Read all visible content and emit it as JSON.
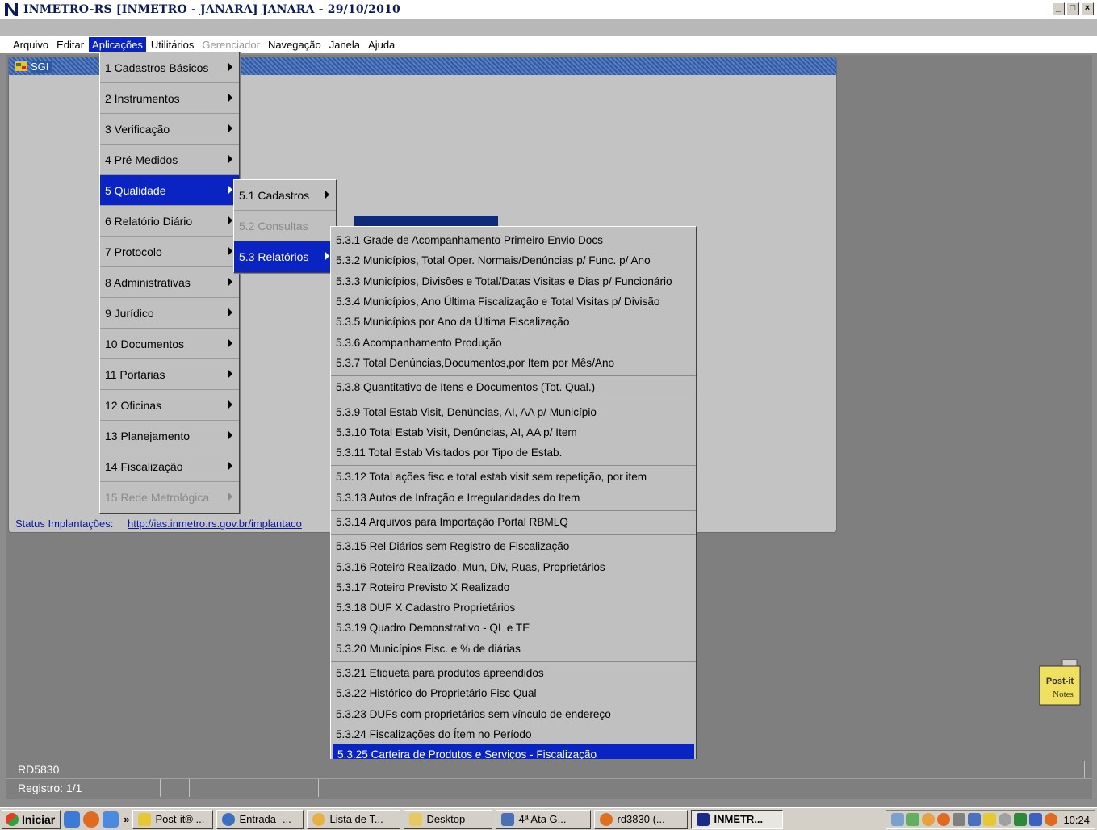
{
  "window": {
    "title": "INMETRO-RS  [INMETRO - JANARA]   JANARA - 29/10/2010",
    "controls": [
      "_",
      "□",
      "×"
    ]
  },
  "menubar": {
    "items": [
      {
        "label": "Arquivo",
        "state": "normal"
      },
      {
        "label": "Editar",
        "state": "normal"
      },
      {
        "label": "Aplicações",
        "state": "active"
      },
      {
        "label": "Utilitários",
        "state": "normal"
      },
      {
        "label": "Gerenciador",
        "state": "disabled"
      },
      {
        "label": "Navegação",
        "state": "normal"
      },
      {
        "label": "Janela",
        "state": "normal"
      },
      {
        "label": "Ajuda",
        "state": "normal"
      }
    ]
  },
  "sgi": {
    "title": "SGI",
    "status_label": "Status Implantações:",
    "status_link": "http://ias.inmetro.rs.gov.br/implantaco"
  },
  "menu_l1": [
    {
      "label": "1 Cadastros Básicos",
      "state": "normal"
    },
    {
      "label": "2 Instrumentos",
      "state": "normal"
    },
    {
      "label": "3 Verificação",
      "state": "normal"
    },
    {
      "label": "4 Pré Medidos",
      "state": "normal"
    },
    {
      "label": "5 Qualidade",
      "state": "active"
    },
    {
      "label": "6 Relatório Diário",
      "state": "normal"
    },
    {
      "label": "7 Protocolo",
      "state": "normal"
    },
    {
      "label": "8 Administrativas",
      "state": "normal"
    },
    {
      "label": "9 Jurídico",
      "state": "normal"
    },
    {
      "label": "10 Documentos",
      "state": "normal"
    },
    {
      "label": "11 Portarias",
      "state": "normal"
    },
    {
      "label": "12 Oficinas",
      "state": "normal"
    },
    {
      "label": "13 Planejamento",
      "state": "normal"
    },
    {
      "label": "14 Fiscalização",
      "state": "normal"
    },
    {
      "label": "15 Rede Metrológica",
      "state": "disabled"
    }
  ],
  "menu_l2": [
    {
      "label": "5.1 Cadastros",
      "state": "normal"
    },
    {
      "label": "5.2 Consultas",
      "state": "disabled"
    },
    {
      "label": "5.3 Relatórios",
      "state": "active"
    }
  ],
  "menu_l3": {
    "groups": [
      {
        "items": [
          "5.3.1 Grade de Acompanhamento Primeiro Envio Docs",
          "5.3.2 Municípios, Total Oper. Normais/Denúncias p/ Func. p/ Ano",
          "5.3.3 Municípios, Divisões e Total/Datas Visitas e Dias p/ Funcionário",
          "5.3.4 Municípios, Ano Última Fiscalização e Total Visitas p/ Divisão",
          "5.3.5 Municípios por Ano da Última Fiscalização",
          "5.3.6 Acompanhamento Produção",
          "5.3.7 Total Denúncias,Documentos,por Item por Mês/Ano"
        ]
      },
      {
        "items": [
          "5.3.8 Quantitativo de Itens e Documentos (Tot. Qual.)"
        ]
      },
      {
        "items": [
          "5.3.9 Total Estab Visit, Denúncias, AI, AA p/ Município",
          "5.3.10 Total Estab Visit, Denúncias, AI, AA p/ Item",
          "5.3.11 Total Estab Visitados por Tipo de Estab."
        ]
      },
      {
        "items": [
          "5.3.12 Total ações fisc e total estab visit sem repetição, por item",
          "5.3.13 Autos de Infração e Irregularidades do Item"
        ]
      },
      {
        "items": [
          "5.3.14 Arquivos para Importação Portal RBMLQ"
        ]
      },
      {
        "items": [
          "5.3.15 Rel Diários sem Registro de Fiscalização",
          "5.3.16 Roteiro Realizado, Mun, Div, Ruas, Proprietários",
          "5.3.17 Roteiro Previsto X Realizado",
          "5.3.18 DUF X Cadastro Proprietários",
          "5.3.19 Quadro Demonstrativo - QL e TE",
          "5.3.20 Municípios Fisc. e % de diárias"
        ]
      },
      {
        "items": [
          "5.3.21 Etiqueta para produtos apreendidos",
          "5.3.22 Histórico do Proprietário Fisc Qual",
          "5.3.23 DUFs com proprietários sem vínculo de endereço",
          "5.3.24 Fiscalizações do Ítem no Período",
          "5.3.25 Carteira de Produtos e Serviços - Fiscalização"
        ]
      }
    ],
    "active_item": "5.3.25 Carteira de Produtos e Serviços - Fiscalização"
  },
  "postit": {
    "line1": "Post-it",
    "line2": "Notes"
  },
  "statusbar": {
    "form_name": "RD5830",
    "record": "Registro: 1/1"
  },
  "taskbar": {
    "start_label": "Iniciar",
    "chevron": "»",
    "tasks": [
      {
        "label": "Post-it® ...",
        "color": "#e8c832",
        "active": false
      },
      {
        "label": "Entrada -...",
        "color": "#3a6fc4",
        "active": false
      },
      {
        "label": "Lista de T...",
        "color": "#e8b040",
        "active": false
      },
      {
        "label": "Desktop",
        "color": "#e8c860",
        "active": false
      },
      {
        "label": "4ª Ata G...",
        "color": "#4a6fb8",
        "active": false
      },
      {
        "label": "rd3830 (...",
        "color": "#e07020",
        "active": false
      },
      {
        "label": "INMETR...",
        "color": "#1a2a8a",
        "active": true
      }
    ],
    "clock": "10:24"
  },
  "colors": {
    "menu_highlight": "#0a24c4",
    "title_text": "#0a1a5c",
    "menu_bg": "#c0c0c0"
  }
}
